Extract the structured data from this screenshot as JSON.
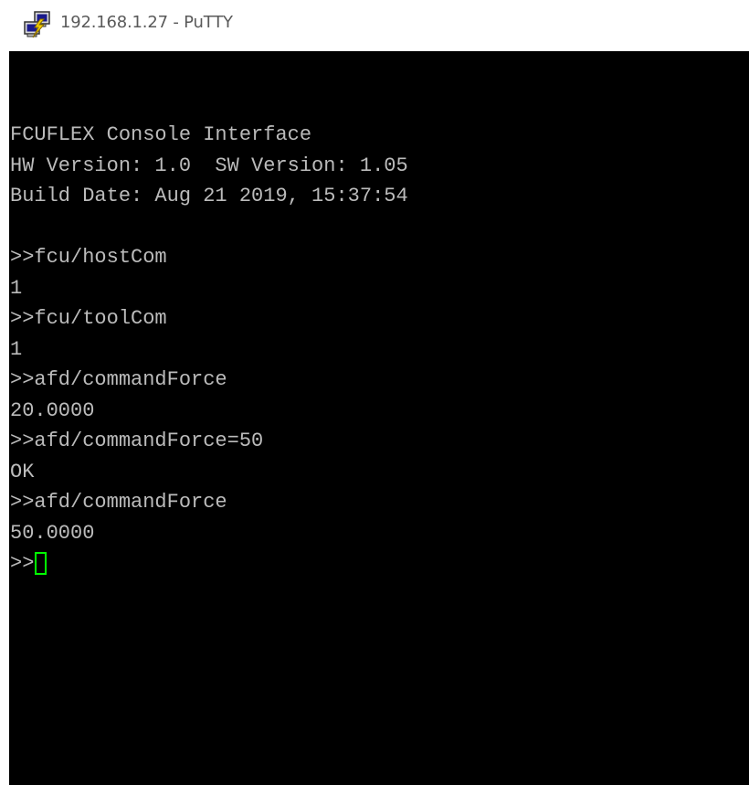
{
  "window": {
    "title": "192.168.1.27 - PuTTY",
    "icon": "putty-icon"
  },
  "terminal": {
    "background": "#000000",
    "foreground": "#bbbbbb",
    "cursor_color": "#00ff00",
    "lines": [
      "FCUFLEX Console Interface",
      "HW Version: 1.0  SW Version: 1.05",
      "Build Date: Aug 21 2019, 15:37:54",
      "",
      ">>fcu/hostCom",
      "1",
      ">>fcu/toolCom",
      "1",
      ">>afd/commandForce",
      "20.0000",
      ">>afd/commandForce=50",
      "OK",
      ">>afd/commandForce",
      "50.0000"
    ],
    "prompt": ">>"
  }
}
